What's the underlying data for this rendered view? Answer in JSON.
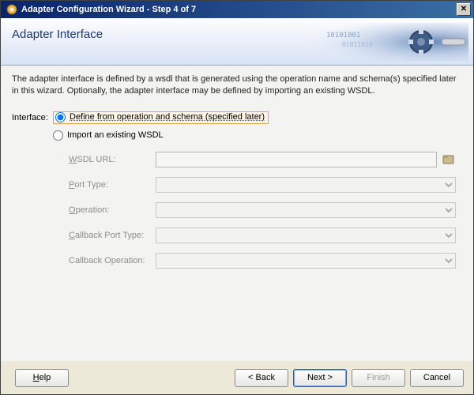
{
  "window": {
    "title": "Adapter Configuration Wizard - Step 4 of 7"
  },
  "header": {
    "title": "Adapter Interface"
  },
  "description": "The adapter interface is defined by a wsdl that is generated using the operation name and schema(s) specified later in this wizard.  Optionally, the adapter interface may be defined by importing an existing WSDL.",
  "iface": {
    "label": "Interface:",
    "option1": "Define from operation and schema (specified later)",
    "option2": "Import an existing WSDL",
    "selected": 0
  },
  "fields": {
    "wsdl_url_label": "WSDL URL:",
    "wsdl_url_value": "",
    "port_type_label": "Port Type:",
    "operation_label": "Operation:",
    "cb_port_type_label": "Callback Port Type:",
    "cb_operation_label": "Callback Operation:"
  },
  "buttons": {
    "help": "Help",
    "back": "< Back",
    "next": "Next >",
    "finish": "Finish",
    "cancel": "Cancel"
  }
}
